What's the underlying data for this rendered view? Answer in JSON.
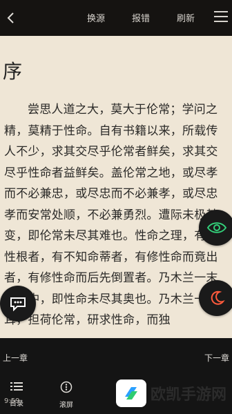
{
  "header": {
    "tabs": [
      "换源",
      "报错",
      "刷新"
    ]
  },
  "content": {
    "chapter_title": "序",
    "paragraph": "尝思人道之大，莫大于伦常；学问之精，莫精于性命。自有书籍以来，所载传人不少，求其交尽乎伦常者鲜矣，求其交尽乎性命者益鲜矣。盖伦常之地，或尽孝而不必兼忠，或尽忠而不必兼孝，或尽忠孝而安常处顺，不必兼勇烈。遭际未极其变，即伦常未尽其难也。性命之理，有悟性根者，有不知命蒂者，有修性命而竟出者，有修性命而后先倒置者。乃木兰一末得其中，即性命未尽其奥也。乃木兰一生耳，担荷伦常，研求性命，而独"
  },
  "footer": {
    "prev_label": "上一章",
    "next_label": "下一章",
    "menu_label": "目录",
    "scroll_label": "滚屏",
    "time": "9:59"
  },
  "watermark": {
    "text": "欧凯手游网"
  },
  "colors": {
    "background": "#efe6d6",
    "topbar": "#151311",
    "bottombar": "#141414",
    "eye_accent": "#33d07a",
    "moon_accent": "#ff5a3c"
  }
}
